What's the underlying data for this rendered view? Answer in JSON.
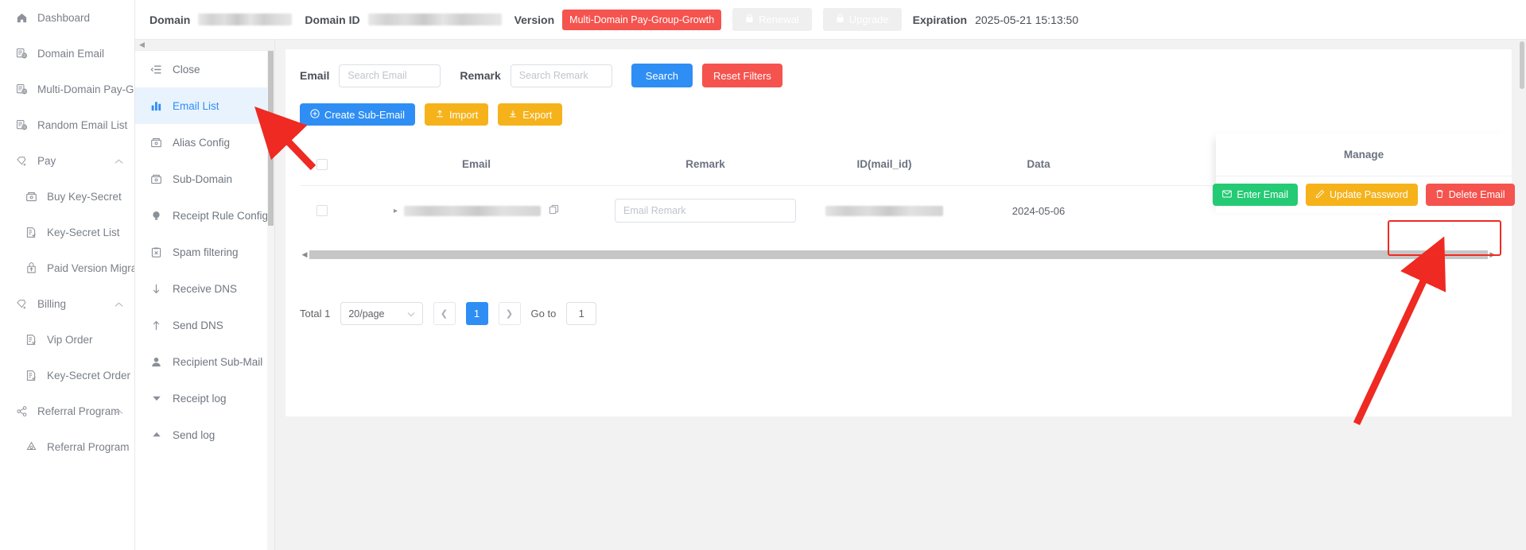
{
  "sidebar": {
    "items": [
      {
        "label": "Dashboard",
        "icon": "home-icon",
        "level": 0,
        "arrow": ""
      },
      {
        "label": "Domain Email",
        "icon": "domain-email-icon",
        "level": 0,
        "arrow": ""
      },
      {
        "label": "Multi-Domain Pay-Group",
        "icon": "domain-email-icon",
        "level": 0,
        "arrow": ""
      },
      {
        "label": "Random Email List",
        "icon": "domain-email-icon",
        "level": 0,
        "arrow": ""
      },
      {
        "label": "Pay",
        "icon": "diamond-icon",
        "level": 0,
        "arrow": "chevron-up-icon"
      },
      {
        "label": "Buy Key-Secret",
        "icon": "wallet-icon",
        "level": 1,
        "arrow": ""
      },
      {
        "label": "Key-Secret List",
        "icon": "doc-check-icon",
        "level": 1,
        "arrow": ""
      },
      {
        "label": "Paid Version Migration",
        "icon": "upload-bag-icon",
        "level": 1,
        "arrow": ""
      },
      {
        "label": "Billing",
        "icon": "diamond-icon",
        "level": 0,
        "arrow": "chevron-up-icon"
      },
      {
        "label": "Vip Order",
        "icon": "doc-check-icon",
        "level": 1,
        "arrow": ""
      },
      {
        "label": "Key-Secret Order",
        "icon": "doc-check-icon",
        "level": 1,
        "arrow": ""
      },
      {
        "label": "Referral Program",
        "icon": "share-icon",
        "level": 0,
        "arrow": "chevron-up-icon"
      },
      {
        "label": "Referral Program",
        "icon": "referral-icon",
        "level": 1,
        "arrow": ""
      }
    ]
  },
  "header": {
    "domain_label": "Domain",
    "domain_value": "",
    "domain_id_label": "Domain ID",
    "domain_id_value": "",
    "version_label": "Version",
    "version_badge": "Multi-Domain Pay-Group-Growth",
    "renewal_button": "Renewal",
    "upgrade_button": "Upgrade",
    "expiration_label": "Expiration",
    "expiration_value": "2025-05-21 15:13:50",
    "colors": {
      "version_badge_bg": "#f5534e",
      "green_button_bg": "#25c75"
    }
  },
  "secondary_sidebar": {
    "items": [
      {
        "label": "Close",
        "icon": "collapse-menu-icon",
        "active": false
      },
      {
        "label": "Email List",
        "icon": "bar-chart-icon",
        "active": true
      },
      {
        "label": "Alias Config",
        "icon": "wallet-icon",
        "active": false
      },
      {
        "label": "Sub-Domain",
        "icon": "wallet-icon",
        "active": false
      },
      {
        "label": "Receipt Rule Config",
        "icon": "bulb-icon",
        "active": false
      },
      {
        "label": "Spam filtering",
        "icon": "clipboard-x-icon",
        "active": false
      },
      {
        "label": "Receive DNS",
        "icon": "arrow-down-icon",
        "active": false
      },
      {
        "label": "Send DNS",
        "icon": "arrow-up-icon",
        "active": false
      },
      {
        "label": "Recipient Sub-Mail",
        "icon": "user-icon",
        "active": false
      },
      {
        "label": "Receipt log",
        "icon": "caret-down-icon",
        "active": false
      },
      {
        "label": "Send log",
        "icon": "caret-up-icon",
        "active": false
      }
    ]
  },
  "filters": {
    "email_label": "Email",
    "email_placeholder": "Search Email",
    "email_value": "",
    "remark_label": "Remark",
    "remark_placeholder": "Search Remark",
    "remark_value": "",
    "search_button": "Search",
    "reset_button": "Reset Filters"
  },
  "actions": {
    "create_button": "Create Sub-Email",
    "import_button": "Import",
    "export_button": "Export"
  },
  "table": {
    "columns": [
      "",
      "Email",
      "Remark",
      "ID(mail_id)",
      "Data",
      "Manage"
    ],
    "manage_header": "Manage",
    "date_header_visible": "Data",
    "rows": [
      {
        "email": "",
        "remark_placeholder": "Email Remark",
        "remark_value": "",
        "mail_id": "",
        "date": "2024-05-06",
        "enter_button": "Enter Email",
        "update_button": "Update Password",
        "delete_button": "Delete Email"
      }
    ]
  },
  "pagination": {
    "total_label": "Total 1",
    "page_size": "20/page",
    "current_page": "1",
    "goto_label": "Go to",
    "goto_value": "1"
  }
}
